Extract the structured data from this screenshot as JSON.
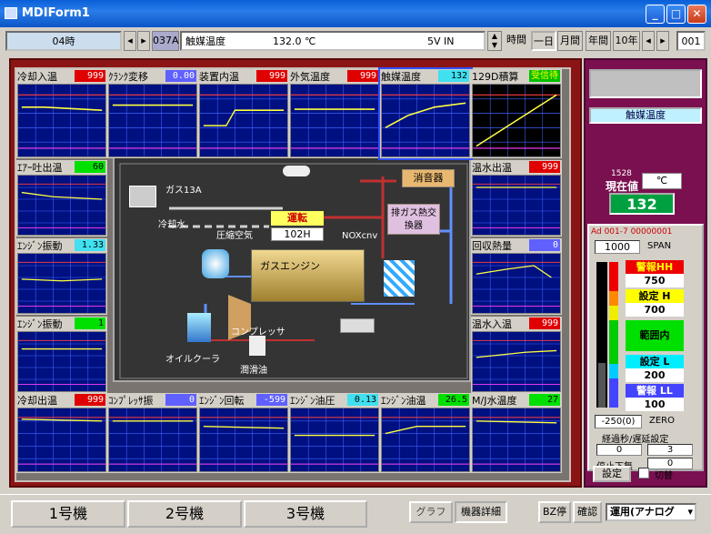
{
  "window": {
    "title": "MDIForm1"
  },
  "toolbar": {
    "time": "04時",
    "code": "037A",
    "tag": "触媒温度",
    "value": "132.0 ℃",
    "range": "5V IN",
    "mode_label": "時間",
    "btn_day": "一日",
    "btn_month": "月間",
    "btn_year": "年間",
    "btn_10y": "10年",
    "page": "001"
  },
  "panels": [
    {
      "label": "冷却入温",
      "value": "999",
      "vcolor": "#e00000",
      "tcolor": "#ffffff"
    },
    {
      "label": "ｸﾗﾝｸ変移",
      "value": "0.00",
      "vcolor": "#6060ff",
      "tcolor": "#ffffff"
    },
    {
      "label": "装置内温",
      "value": "999",
      "vcolor": "#e00000",
      "tcolor": "#ffffff"
    },
    {
      "label": "外気温度",
      "value": "999",
      "vcolor": "#e00000",
      "tcolor": "#ffffff"
    },
    {
      "label": "触媒温度",
      "value": "132",
      "vcolor": "#40e0f0",
      "tcolor": "#000000"
    },
    {
      "label": "129D積算",
      "value": "受信待",
      "vcolor": "#00c000",
      "tcolor": "#ffff00"
    },
    {
      "label": "ｴｱｰ吐出温",
      "value": "60",
      "vcolor": "#00e000",
      "tcolor": "#000000"
    },
    {
      "label": "温水出温",
      "value": "999",
      "vcolor": "#e00000",
      "tcolor": "#ffffff"
    },
    {
      "label": "ｴﾝｼﾞﾝ振動",
      "value": "1.33",
      "vcolor": "#40e0f0",
      "tcolor": "#000000"
    },
    {
      "label": "回収熱量",
      "value": "0",
      "vcolor": "#6060ff",
      "tcolor": "#ffffff"
    },
    {
      "label": "ｴﾝｼﾞﾝ振動",
      "value": "1",
      "vcolor": "#00e000",
      "tcolor": "#000000"
    },
    {
      "label": "温水入温",
      "value": "999",
      "vcolor": "#e00000",
      "tcolor": "#ffffff"
    },
    {
      "label": "冷却出温",
      "value": "999",
      "vcolor": "#e00000",
      "tcolor": "#ffffff"
    },
    {
      "label": "ｺﾝﾌﾟﾚｯｻ振",
      "value": "0",
      "vcolor": "#6060ff",
      "tcolor": "#ffffff"
    },
    {
      "label": "ｴﾝｼﾞﾝ回転",
      "value": "-599",
      "vcolor": "#6060ff",
      "tcolor": "#ffffff"
    },
    {
      "label": "ｴﾝｼﾞﾝ油圧",
      "value": "0.13",
      "vcolor": "#40e0f0",
      "tcolor": "#000000"
    },
    {
      "label": "ｴﾝｼﾞﾝ油温",
      "value": "26.5",
      "vcolor": "#00e000",
      "tcolor": "#000000"
    },
    {
      "label": "M/J水温度",
      "value": "27",
      "vcolor": "#00e000",
      "tcolor": "#000000"
    }
  ],
  "diagram": {
    "gas": "ガス13A",
    "cooler": "冷却水",
    "air": "圧縮空気",
    "run": "運転",
    "hours": "102H",
    "engine": "ガスエンジン",
    "muffler": "消音器",
    "hx": "排ガス熱交換器",
    "nox": "NOXcnv",
    "comp": "コンプレッサ",
    "oil_cooler": "オイルクーラ",
    "lube": "潤滑油"
  },
  "side": {
    "tag": "触媒温度",
    "num": "1528",
    "pv_label": "現在値",
    "unit": "℃",
    "pv": "132",
    "adr": "Ad 001-7 00000001",
    "span": "1000",
    "span_label": "SPAN",
    "hh_label": "警報HH",
    "hh": "750",
    "h_label": "設定 H",
    "h": "700",
    "range_label": "範囲内",
    "l_label": "設定 L",
    "l": "200",
    "ll_label": "警報 LL",
    "ll": "100",
    "zero": "-250(0)",
    "zero_label": "ZERO",
    "delay_label": "経過秒/遅延設定",
    "d1": "0",
    "d2": "3",
    "stop_label": "停止下無",
    "stop": "0",
    "set_btn": "設定",
    "switch_label": "切替"
  },
  "bottom": {
    "unit1": "1号機",
    "unit2": "2号機",
    "unit3": "3号機",
    "graph": "グラフ",
    "detail": "機器詳細",
    "bz": "BZ停",
    "confirm": "確認",
    "mode": "運用(アナログ"
  }
}
